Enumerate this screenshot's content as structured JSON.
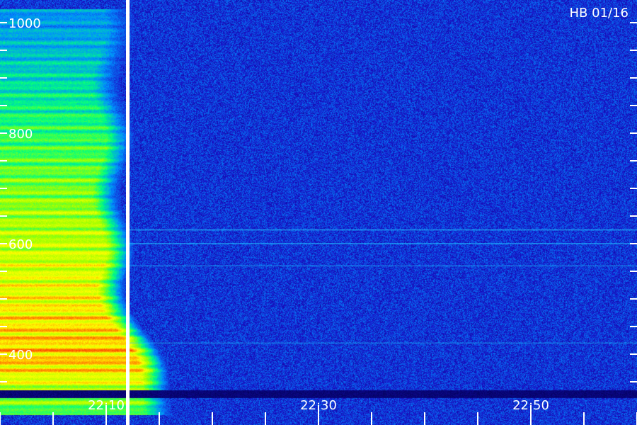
{
  "chart_data": {
    "type": "heatmap",
    "title": "HB 01/16",
    "xlabel": "",
    "ylabel": "",
    "x_tick_labels": [
      "22:10",
      "22:30",
      "22:50"
    ],
    "y_tick_labels": [
      "400",
      "600",
      "800",
      "1000"
    ],
    "ylim": [
      350,
      1050
    ],
    "xlim_minutes": [
      0,
      60
    ],
    "colormap": [
      "#000050",
      "#1a10c8",
      "#0090ff",
      "#00ff80",
      "#a0ff00",
      "#ffff00",
      "#ff8000",
      "#ff0000"
    ],
    "background_level": "low (dark blue)",
    "emission_band": {
      "time_range": [
        "21:58",
        "22:12"
      ],
      "frequency_range": [
        380,
        1000
      ],
      "peak_frequency": 420,
      "peak_color": "red"
    },
    "vertical_marker_time": "22:12",
    "horizontal_lines_frequency": [
      625,
      600,
      560,
      420
    ]
  }
}
